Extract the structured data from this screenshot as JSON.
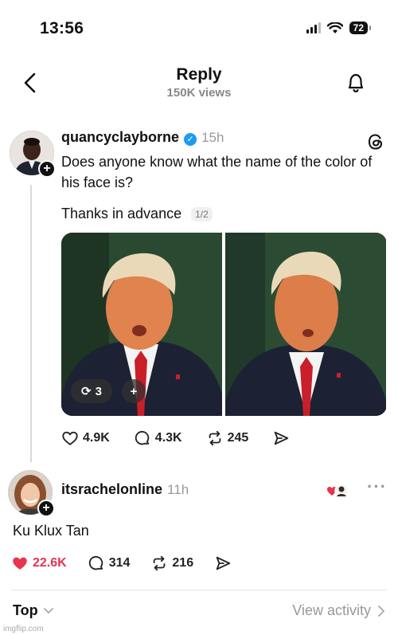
{
  "status_bar": {
    "time": "13:56",
    "battery": "72"
  },
  "nav": {
    "title": "Reply",
    "subtitle": "150K views"
  },
  "post": {
    "username": "quancyclayborne",
    "time": "15h",
    "text": "Does anyone know what the name of the color of his face is?",
    "text2": "Thanks in advance",
    "page_badge": "1/2",
    "media_repost_count": "3",
    "media_add_label": "+",
    "likes": "4.9K",
    "comments": "4.3K",
    "reposts": "245"
  },
  "reply": {
    "username": "itsrachelonline",
    "time": "11h",
    "text": "Ku Klux Tan",
    "likes": "22.6K",
    "comments": "314",
    "reposts": "216",
    "more": "···"
  },
  "bottom": {
    "sort_label": "Top",
    "view_activity_label": "View activity"
  },
  "watermark": "imgflip.com",
  "colors": {
    "verified": "#1d9bf0",
    "like_red": "#e8344e",
    "muted": "#888888"
  }
}
